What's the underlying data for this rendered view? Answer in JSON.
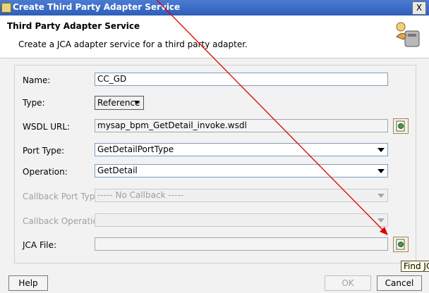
{
  "window": {
    "title": "Create Third Party Adapter Service",
    "close_glyph": "X"
  },
  "header": {
    "title": "Third Party Adapter Service",
    "description": "Create a JCA adapter service for a third party adapter.",
    "icon": "adapter-wizard-icon"
  },
  "form": {
    "name": {
      "label": "Name:",
      "value": "CC_GD"
    },
    "type": {
      "label": "Type:",
      "value": "Reference"
    },
    "wsdl_url": {
      "label": "WSDL URL:",
      "value": "mysap_bpm_GetDetail_invoke.wsdl"
    },
    "port_type": {
      "label": "Port Type:",
      "value": "GetDetailPortType"
    },
    "operation": {
      "label": "Operation:",
      "value": "GetDetail"
    },
    "callback_port_type": {
      "label": "Callback Port Type:",
      "value": "----- No Callback -----"
    },
    "callback_operation": {
      "label": "Callback Operation:",
      "value": ""
    },
    "jca_file": {
      "label": "JCA File:",
      "value": ""
    }
  },
  "buttons": {
    "help": "Help",
    "ok": "OK",
    "cancel": "Cancel"
  },
  "tooltip": {
    "text": "Find JCA File"
  },
  "colors": {
    "titlebar": "#2f5fb8",
    "annotation_arrow": "#e00000",
    "field_border": "#7f9db9"
  }
}
